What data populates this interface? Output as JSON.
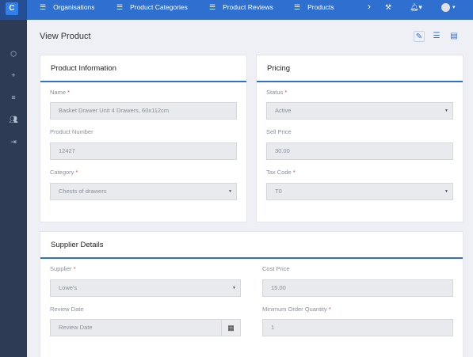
{
  "app": {
    "logo_letter": "C"
  },
  "nav": {
    "items": [
      {
        "label": "Organisations"
      },
      {
        "label": "Product Categories"
      },
      {
        "label": "Product Reviews"
      },
      {
        "label": "Products"
      }
    ],
    "icons": [
      "chevron-right-icon",
      "wrench-icon",
      "bell-icon",
      "user-icon"
    ]
  },
  "sidebar": {
    "icons": [
      "cube-icon",
      "plus-icon",
      "list-icon",
      "users-icon",
      "logout-icon"
    ]
  },
  "page": {
    "title": "View Product"
  },
  "product_info": {
    "heading": "Product Information",
    "name_label": "Name",
    "name_value": "Basket Drawer Unit 4 Drawers, 60x112cm",
    "number_label": "Product Number",
    "number_value": "12427",
    "category_label": "Category",
    "category_value": "Chests of drawers"
  },
  "pricing": {
    "heading": "Pricing",
    "status_label": "Status",
    "status_value": "Active",
    "sell_label": "Sell Price",
    "sell_value": "30.00",
    "tax_label": "Tax Code",
    "tax_value": "T0"
  },
  "supplier": {
    "heading": "Supplier Details",
    "supplier_label": "Supplier",
    "supplier_value": "Lowe's",
    "review_label": "Review Date",
    "review_placeholder": "Review Date",
    "cost_label": "Cost Price",
    "cost_value": "15.00",
    "min_label": "Minimum Order Quantity",
    "min_value": "1"
  },
  "colors": {
    "accent": "#2f6fd0",
    "sidebar": "#2e3b55",
    "required": "#e0454a"
  }
}
